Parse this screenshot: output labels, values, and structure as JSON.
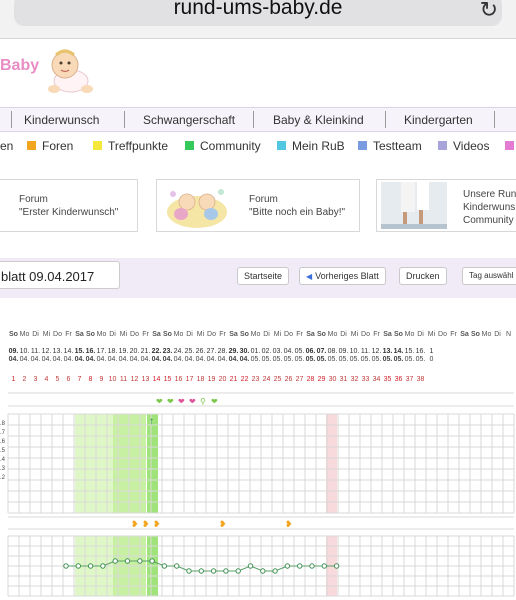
{
  "browser": {
    "url": "rund-ums-baby.de",
    "reload_glyph": "↻"
  },
  "site": {
    "logo_text": "Baby"
  },
  "nav": {
    "items": [
      "Kinderwunsch",
      "Schwangerschaft",
      "Baby & Kleinkind",
      "Kindergarten"
    ],
    "separator_count": 5
  },
  "subnav": {
    "items": [
      {
        "label": "en",
        "color": ""
      },
      {
        "label": "Foren",
        "color": "#f2a51f"
      },
      {
        "label": "Treffpunkte",
        "color": "#f4e83a"
      },
      {
        "label": "Community",
        "color": "#35c95c"
      },
      {
        "label": "Mein RuB",
        "color": "#52c7e2"
      },
      {
        "label": "Testteam",
        "color": "#7a9be0"
      },
      {
        "label": "Videos",
        "color": "#a7a4d9"
      }
    ]
  },
  "forum_boxes": [
    {
      "line1": "Forum",
      "line2": "\"Erster Kinderwunsch\""
    },
    {
      "line1": "Forum",
      "line2": "\"Bitte noch ein Baby!\""
    },
    {
      "line1": "Unsere Run",
      "line2": "Kinderwuns",
      "line3": "Community"
    }
  ],
  "datebar": {
    "blatt": "blatt 09.04.2017",
    "start": "Startseite",
    "prev": "Vorheriges Blatt",
    "print": "Drucken",
    "select_day": "Tag auswähl"
  },
  "cycle": {
    "weekdays": [
      "So",
      "Mo",
      "Di",
      "Mi",
      "Do",
      "Fr",
      "Sa",
      "So",
      "Mo",
      "Di",
      "Mi",
      "Do",
      "Fr",
      "Sa",
      "So",
      "Mo",
      "Di",
      "Mi",
      "Do",
      "Fr",
      "Sa",
      "So",
      "Mo",
      "Di",
      "Mi",
      "Do",
      "Fr",
      "Sa",
      "So",
      "Mo",
      "Di",
      "Mi",
      "Do",
      "Fr",
      "Sa",
      "So",
      "Mo",
      "Di",
      "Mi",
      "Do",
      "Fr",
      "Sa",
      "So",
      "Mo",
      "Di",
      "N"
    ],
    "dates_day": [
      "09.",
      "10.",
      "11.",
      "12.",
      "13.",
      "14.",
      "15.",
      "16.",
      "17.",
      "18.",
      "19.",
      "20.",
      "21.",
      "22.",
      "23.",
      "24.",
      "25.",
      "26.",
      "27.",
      "28.",
      "29.",
      "30.",
      "01.",
      "02.",
      "03.",
      "04.",
      "05.",
      "06.",
      "07.",
      "08.",
      "09.",
      "10.",
      "11.",
      "12.",
      "13.",
      "14.",
      "15.",
      "16.",
      "1"
    ],
    "dates_month": [
      "04.",
      "04.",
      "04.",
      "04.",
      "04.",
      "04.",
      "04.",
      "04.",
      "04.",
      "04.",
      "04.",
      "04.",
      "04.",
      "04.",
      "04.",
      "04.",
      "04.",
      "04.",
      "04.",
      "04.",
      "04.",
      "04.",
      "05.",
      "05.",
      "05.",
      "05.",
      "05.",
      "05.",
      "05.",
      "05.",
      "05.",
      "05.",
      "05.",
      "05.",
      "05.",
      "05.",
      "05.",
      "05.",
      "0"
    ],
    "cycle_days": [
      "1",
      "2",
      "3",
      "4",
      "5",
      "6",
      "7",
      "8",
      "9",
      "10",
      "11",
      "12",
      "13",
      "14",
      "15",
      "16",
      "17",
      "18",
      "19",
      "20",
      "21",
      "22",
      "23",
      "24",
      "25",
      "26",
      "27",
      "28",
      "29",
      "30",
      "31",
      "32",
      "33",
      "34",
      "35",
      "36",
      "37",
      "38"
    ],
    "temp_axis_labels": [
      ".8",
      ".7",
      ".6",
      ".5",
      ".4",
      ".3",
      ".2"
    ],
    "temperature_levels": [
      2,
      2,
      2,
      2,
      3,
      3,
      3,
      3,
      2,
      2,
      1,
      1,
      1,
      1,
      1,
      2,
      1,
      1,
      2,
      2,
      2,
      2,
      2
    ]
  },
  "colors": {
    "fertile_light": "#dff7c7",
    "fertile_mid": "#c8f0a3",
    "fertile_strong": "#9fe37a",
    "marker_pink": "#f8d9dc",
    "grid": "#d8d8d8",
    "accent_purple": "#f0ebf7"
  }
}
